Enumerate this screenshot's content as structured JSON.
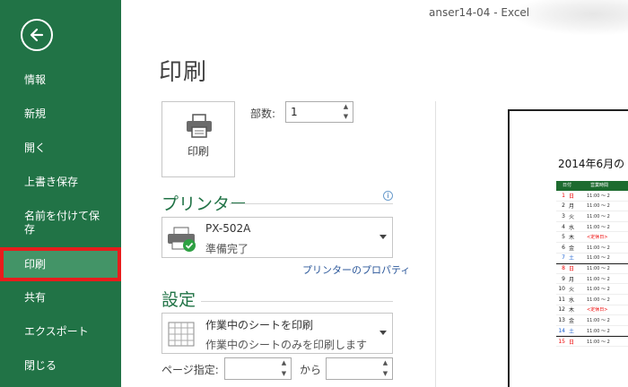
{
  "window": {
    "title": "anser14-04 - Excel"
  },
  "sidebar": {
    "items": [
      {
        "label": "情報"
      },
      {
        "label": "新規"
      },
      {
        "label": "開く"
      },
      {
        "label": "上書き保存"
      },
      {
        "label": "名前を付けて保存"
      },
      {
        "label": "印刷"
      },
      {
        "label": "共有"
      },
      {
        "label": "エクスポート"
      },
      {
        "label": "閉じる"
      }
    ],
    "active": "印刷"
  },
  "main": {
    "title": "印刷",
    "print_button": "印刷",
    "copies_label": "部数:",
    "copies_value": "1",
    "printer": {
      "heading": "プリンター",
      "name": "PX-502A",
      "status": "準備完了",
      "properties_link": "プリンターのプロパティ"
    },
    "settings": {
      "heading": "設定",
      "scope_title": "作業中のシートを印刷",
      "scope_sub": "作業中のシートのみを印刷します",
      "pages_label": "ページ指定:",
      "to_label": "から"
    }
  },
  "preview": {
    "sheet_title": "2014年6月の",
    "header": [
      "日付",
      "営業時間"
    ],
    "rows": [
      {
        "d": "1",
        "w": "日",
        "t": "11:00 ～ 2",
        "color": "red"
      },
      {
        "d": "2",
        "w": "月",
        "t": "11:00 ～ 2",
        "color": ""
      },
      {
        "d": "3",
        "w": "火",
        "t": "11:00 ～ 2",
        "color": ""
      },
      {
        "d": "4",
        "w": "水",
        "t": "11:00 ～ 2",
        "color": ""
      },
      {
        "d": "5",
        "w": "木",
        "t": "<定休日>",
        "color": "",
        "tred": true
      },
      {
        "d": "6",
        "w": "金",
        "t": "11:00 ～ 2",
        "color": ""
      },
      {
        "d": "7",
        "w": "土",
        "t": "11:00 ～ 2",
        "color": "blue"
      },
      {
        "d": "8",
        "w": "日",
        "t": "11:00 ～ 2",
        "color": "red",
        "sep": true
      },
      {
        "d": "9",
        "w": "月",
        "t": "11:00 ～ 2",
        "color": ""
      },
      {
        "d": "10",
        "w": "火",
        "t": "11:00 ～ 2",
        "color": ""
      },
      {
        "d": "11",
        "w": "水",
        "t": "11:00 ～ 2",
        "color": ""
      },
      {
        "d": "12",
        "w": "木",
        "t": "<定休日>",
        "color": "",
        "tred": true
      },
      {
        "d": "13",
        "w": "金",
        "t": "11:00 ～ 2",
        "color": ""
      },
      {
        "d": "14",
        "w": "土",
        "t": "11:00 ～ 2",
        "color": "blue"
      },
      {
        "d": "15",
        "w": "日",
        "t": "11:00 ～ 2",
        "color": "red",
        "sep": true
      }
    ]
  },
  "colors": {
    "accent": "#217346",
    "active_item": "#439467",
    "highlight_border": "#e81c1c",
    "link": "#2b579a"
  }
}
